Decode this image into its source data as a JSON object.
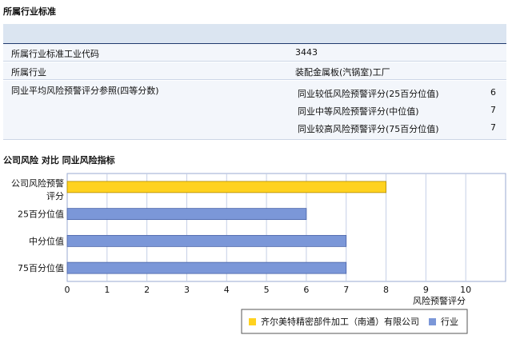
{
  "section1": {
    "title": "所属行业标准"
  },
  "industry_table": {
    "code_label": "所属行业标准工业代码",
    "code_value": "3443",
    "industry_label": "所属行业",
    "industry_value": "装配金属板(汽锅室)工厂",
    "avg_label": "同业平均风险预警评分参照(四等分数)",
    "percentiles": [
      {
        "label": "同业较低风险预警评分(25百分位值)",
        "value": "6"
      },
      {
        "label": "同业中等风险预警评分(中位值)",
        "value": "7"
      },
      {
        "label": "同业较高风险预警评分(75百分位值)",
        "value": "7"
      }
    ]
  },
  "section2": {
    "title": "公司风险 对比 同业风险指标"
  },
  "chart_data": {
    "type": "bar",
    "orientation": "horizontal",
    "categories": [
      "公司风险预警评分",
      "25百分位值",
      "中分位值",
      "75百分位值"
    ],
    "values": [
      8,
      6,
      7,
      7
    ],
    "series": [
      {
        "name": "齐尔美特精密部件加工（南通）有限公司",
        "values": [
          8,
          null,
          null,
          null
        ]
      },
      {
        "name": "行业",
        "values": [
          null,
          6,
          7,
          7
        ]
      }
    ],
    "xlabel": "风险预警评分",
    "xlim": [
      0,
      11
    ],
    "xticks": [
      0,
      1,
      2,
      3,
      4,
      5,
      6,
      7,
      8,
      9,
      10
    ],
    "grid": true,
    "legend_position": "bottom-right",
    "colors": {
      "company": "#ffd21f",
      "industry": "#7b97d8"
    }
  }
}
